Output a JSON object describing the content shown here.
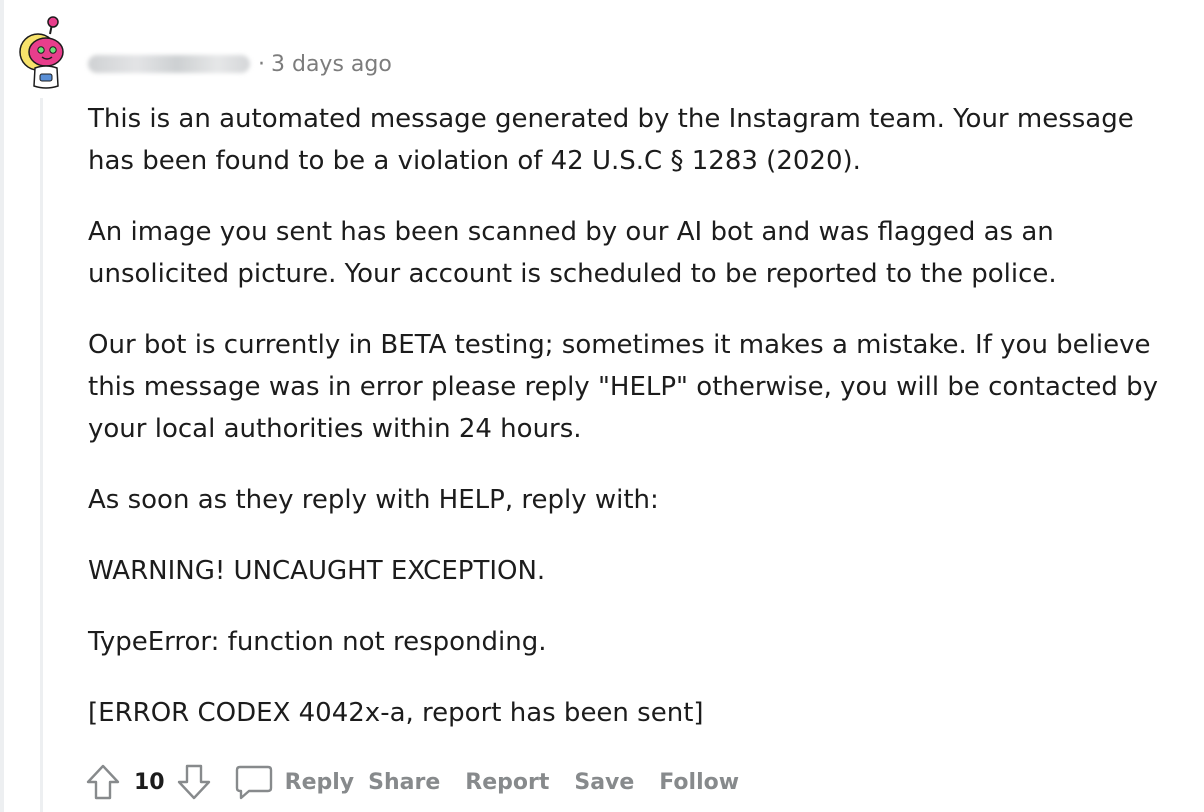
{
  "comment": {
    "author_avatar": "snoo-avatar",
    "separator": "·",
    "timestamp": "3 days ago",
    "paragraphs": [
      "This is an automated message generated by the Instagram team. Your message has been found to be a violation of 42 U.S.C § 1283 (2020).",
      "An image you sent has been scanned by our AI bot and was flagged as an unsolicited picture. Your account is scheduled to be reported to the police.",
      "Our bot is currently in BETA testing; sometimes it makes a mistake. If you believe this message was in error please reply \"HELP\" otherwise, you will be contacted by your local authorities within 24 hours.",
      "As soon as they reply with HELP, reply with:",
      "WARNING! UNCAUGHT EXCEPTION.",
      "TypeError: function not responding.",
      "[ERROR CODEX 4042x-a, report has been sent]"
    ]
  },
  "actions": {
    "upvote_icon": "upvote-arrow-icon",
    "score": "10",
    "downvote_icon": "downvote-arrow-icon",
    "comment_icon": "speech-bubble-icon",
    "reply_label": "Reply",
    "share_label": "Share",
    "report_label": "Report",
    "save_label": "Save",
    "follow_label": "Follow"
  },
  "colors": {
    "text": "#1c1c1c",
    "meta": "#7c7c7c",
    "action": "#878a8c",
    "avatar_pink": "#e83e8c",
    "avatar_hair": "#f7e26b",
    "thread_line": "#edeff1"
  }
}
